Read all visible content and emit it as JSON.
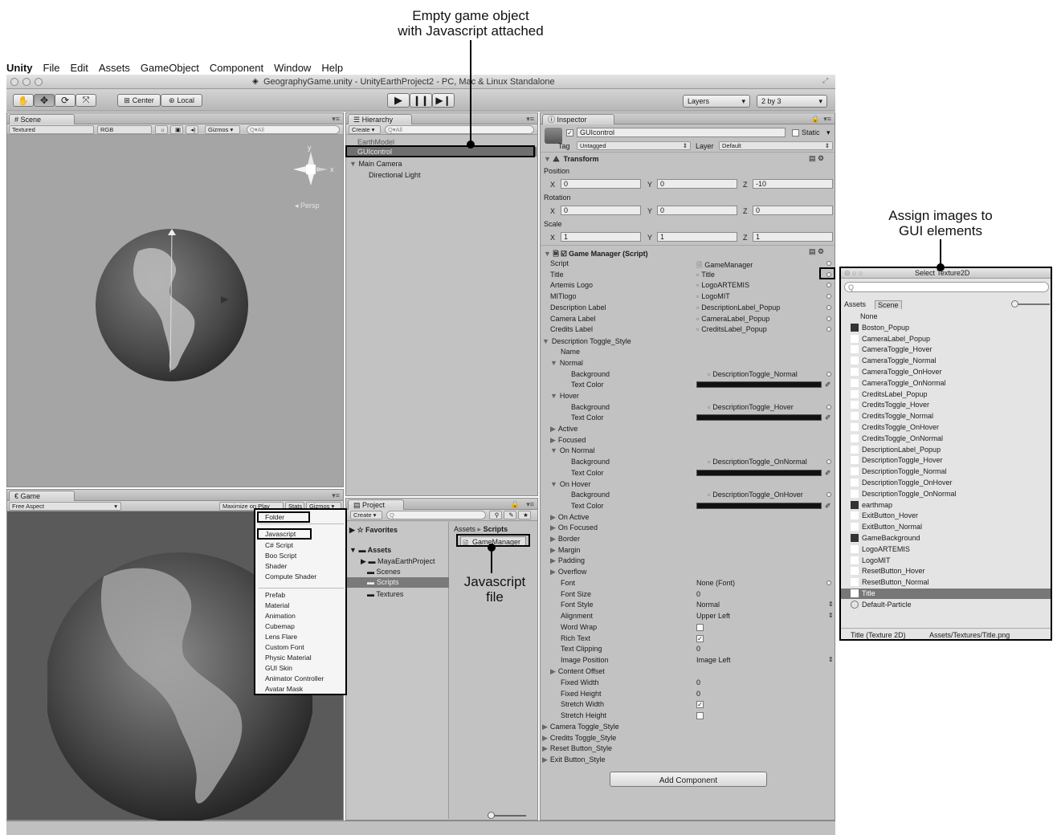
{
  "callouts": {
    "empty_game_object": "Empty game object\nwith Javascript attached",
    "assign_images": "Assign images to\nGUI elements",
    "javascript_file": "Javascript\nfile"
  },
  "menubar": [
    "Unity",
    "File",
    "Edit",
    "Assets",
    "GameObject",
    "Component",
    "Window",
    "Help"
  ],
  "window_title": "GeographyGame.unity - UnityEarthProject2 - PC, Mac & Linux Standalone",
  "toolbar": {
    "center": "Center",
    "local": "Local",
    "layers": "Layers",
    "layout": "2 by 3"
  },
  "scene": {
    "tab": "Scene",
    "textured": "Textured",
    "rgb": "RGB",
    "gizmos": "Gizmos",
    "search_placeholder": "Q▾All",
    "persp": "Persp",
    "axis_x": "x",
    "axis_y": "y"
  },
  "game": {
    "tab": "Game",
    "aspect": "Free Aspect",
    "maximize": "Maximize on Play",
    "stats": "Stats",
    "gizmos": "Gizmos"
  },
  "hierarchy": {
    "tab": "Hierarchy",
    "create": "Create",
    "search_placeholder": "Q▾All",
    "items": [
      "EarthModel",
      "GUIcontrol",
      "Main Camera",
      "Directional Light"
    ]
  },
  "project": {
    "tab": "Project",
    "create": "Create",
    "favorites": "Favorites",
    "assets": "Assets",
    "tree": [
      "MayaEarthProject",
      "Scenes",
      "Scripts",
      "Textures"
    ],
    "breadcrumb_root": "Assets",
    "breadcrumb_child": "Scripts",
    "file": "GameManager"
  },
  "create_menu": {
    "items": [
      "Folder",
      "Javascript",
      "C# Script",
      "Boo Script",
      "Shader",
      "Compute Shader",
      "Prefab",
      "Material",
      "Animation",
      "Cubemap",
      "Lens Flare",
      "Custom Font",
      "Physic Material",
      "GUI Skin",
      "Animator Controller",
      "Avatar Mask"
    ]
  },
  "inspector": {
    "tab": "Inspector",
    "object_name": "GUIcontrol",
    "static_label": "Static",
    "tag_label": "Tag",
    "tag_value": "Untagged",
    "layer_label": "Layer",
    "layer_value": "Default",
    "transform": "Transform",
    "position": "Position",
    "rotation": "Rotation",
    "scale": "Scale",
    "pos": {
      "x": "0",
      "y": "0",
      "z": "-10"
    },
    "rot": {
      "x": "0",
      "y": "0",
      "z": "0"
    },
    "scl": {
      "x": "1",
      "y": "1",
      "z": "1"
    },
    "component": "Game Manager (Script)",
    "script_props": [
      {
        "label": "Script",
        "value": "GameManager"
      },
      {
        "label": "Title",
        "value": "Title"
      },
      {
        "label": "Artemis Logo",
        "value": "LogoARTEMIS"
      },
      {
        "label": "MITlogo",
        "value": "LogoMIT"
      },
      {
        "label": "Description Label",
        "value": "DescriptionLabel_Popup"
      },
      {
        "label": "Camera Label",
        "value": "CameraLabel_Popup"
      },
      {
        "label": "Credits Label",
        "value": "CreditsLabel_Popup"
      }
    ],
    "style_section": "Description Toggle_Style",
    "name_label": "Name",
    "normal": "Normal",
    "hover": "Hover",
    "active": "Active",
    "focused": "Focused",
    "on_normal": "On Normal",
    "on_hover": "On Hover",
    "on_active": "On Active",
    "on_focused": "On Focused",
    "background": "Background",
    "text_color": "Text Color",
    "bg_normal": "DescriptionToggle_Normal",
    "bg_hover": "DescriptionToggle_Hover",
    "bg_on_normal": "DescriptionToggle_OnNormal",
    "bg_on_hover": "DescriptionToggle_OnHover",
    "collapsed": [
      "Border",
      "Margin",
      "Padding",
      "Overflow"
    ],
    "font_props": [
      {
        "label": "Font",
        "value": "None (Font)"
      },
      {
        "label": "Font Size",
        "value": "0"
      },
      {
        "label": "Font Style",
        "value": "Normal"
      },
      {
        "label": "Alignment",
        "value": "Upper Left"
      },
      {
        "label": "Word Wrap",
        "value": ""
      },
      {
        "label": "Rich Text",
        "value": ""
      },
      {
        "label": "Text Clipping",
        "value": "0"
      },
      {
        "label": "Image Position",
        "value": "Image Left"
      }
    ],
    "content_offset": "Content Offset",
    "size_props": [
      {
        "label": "Fixed Width",
        "value": "0"
      },
      {
        "label": "Fixed Height",
        "value": "0"
      },
      {
        "label": "Stretch Width",
        "value": ""
      },
      {
        "label": "Stretch Height",
        "value": ""
      }
    ],
    "other_styles": [
      "Camera Toggle_Style",
      "Credits Toggle_Style",
      "Reset Button_Style",
      "Exit Button_Style"
    ],
    "add_component": "Add Component"
  },
  "texture_picker": {
    "title": "Select Texture2D",
    "tab_assets": "Assets",
    "tab_scene": "Scene",
    "items": [
      "None",
      "Boston_Popup",
      "CameraLabel_Popup",
      "CameraToggle_Hover",
      "CameraToggle_Normal",
      "CameraToggle_OnHover",
      "CameraToggle_OnNormal",
      "CreditsLabel_Popup",
      "CreditsToggle_Hover",
      "CreditsToggle_Normal",
      "CreditsToggle_OnHover",
      "CreditsToggle_OnNormal",
      "DescriptionLabel_Popup",
      "DescriptionToggle_Hover",
      "DescriptionToggle_Normal",
      "DescriptionToggle_OnHover",
      "DescriptionToggle_OnNormal",
      "earthmap",
      "ExitButton_Hover",
      "ExitButton_Normal",
      "GameBackground",
      "LogoARTEMIS",
      "LogoMIT",
      "ResetButton_Hover",
      "ResetButton_Normal",
      "Title",
      "Default-Particle"
    ],
    "selected": "Title",
    "footer_name": "Title (Texture 2D)",
    "footer_path": "Assets/Textures/Title.png"
  }
}
